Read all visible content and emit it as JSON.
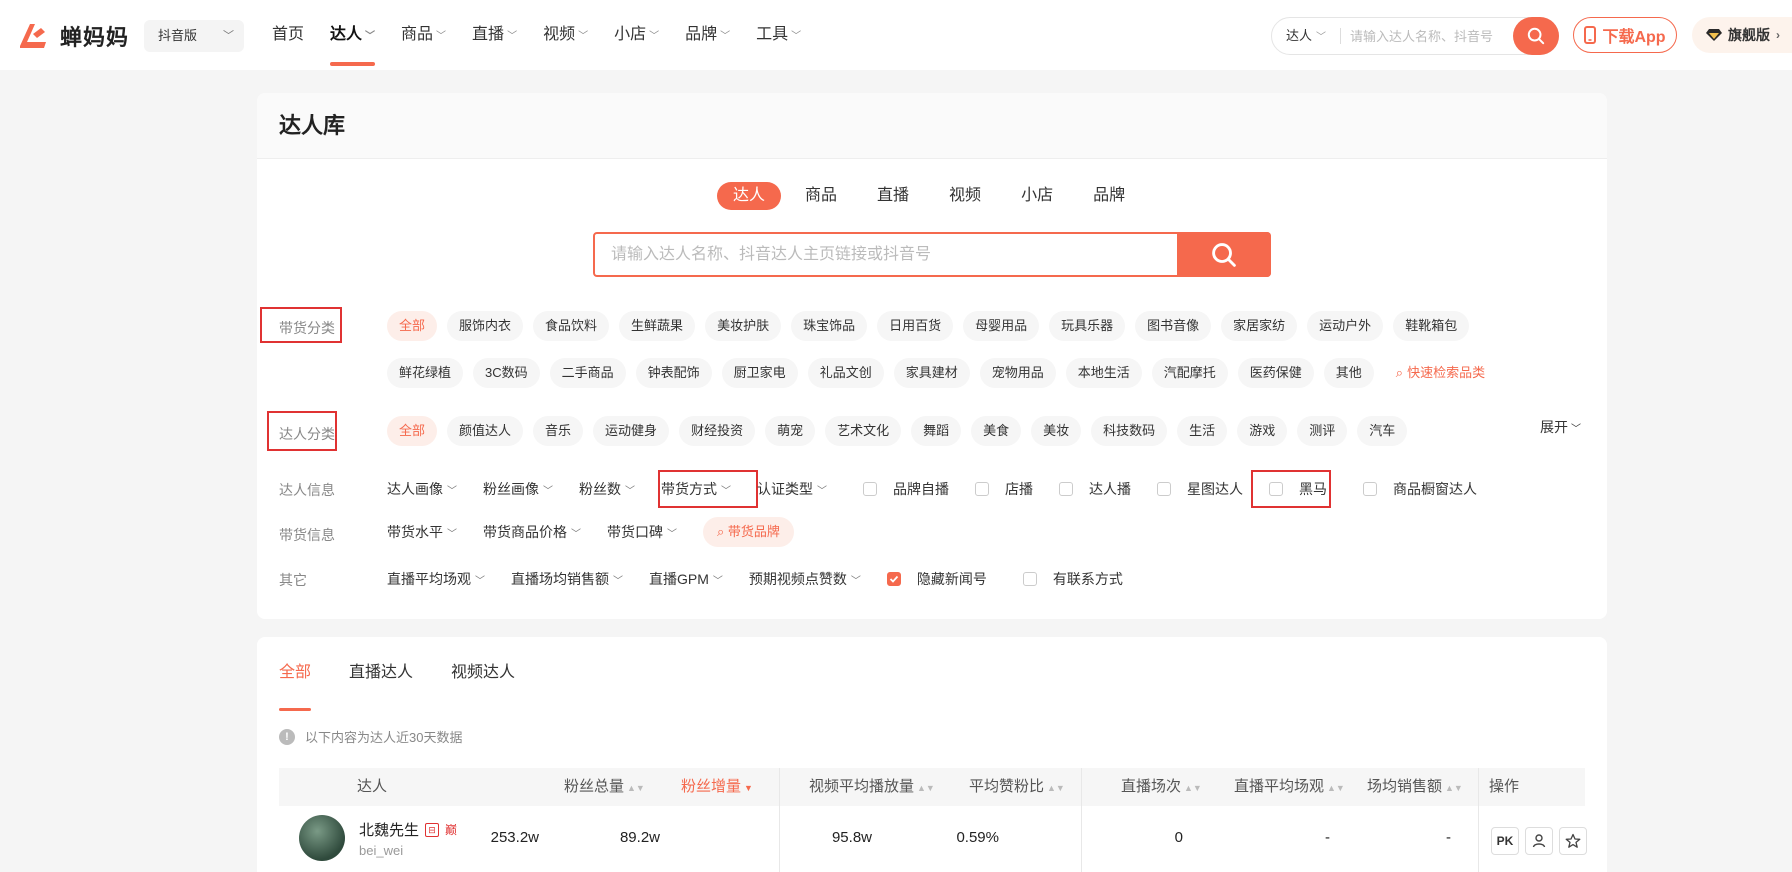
{
  "brand": {
    "name": "蝉妈妈",
    "accent": "#f5694d",
    "platform": "抖音版"
  },
  "nav": [
    {
      "label": "首页",
      "caret": false
    },
    {
      "label": "达人",
      "caret": true,
      "active": true
    },
    {
      "label": "商品",
      "caret": true
    },
    {
      "label": "直播",
      "caret": true
    },
    {
      "label": "视频",
      "caret": true
    },
    {
      "label": "小店",
      "caret": true
    },
    {
      "label": "品牌",
      "caret": true
    },
    {
      "label": "工具",
      "caret": true
    }
  ],
  "top_search": {
    "type": "达人",
    "placeholder": "请输入达人名称、抖音号"
  },
  "download_label": "下载App",
  "vip_label": "旗舰版",
  "page_title": "达人库",
  "type_tabs": [
    "达人",
    "商品",
    "直播",
    "视频",
    "小店",
    "品牌"
  ],
  "main_search": {
    "placeholder": "请输入达人名称、抖音达人主页链接或抖音号"
  },
  "filters": {
    "goods_category": {
      "label": "带货分类",
      "chips": [
        "全部",
        "服饰内衣",
        "食品饮料",
        "生鲜蔬果",
        "美妆护肤",
        "珠宝饰品",
        "日用百货",
        "母婴用品",
        "玩具乐器",
        "图书音像",
        "家居家纺",
        "运动户外",
        "鞋靴箱包",
        "鲜花绿植",
        "3C数码",
        "二手商品",
        "钟表配饰",
        "厨卫家电",
        "礼品文创",
        "家具建材",
        "宠物用品",
        "本地生活",
        "汽配摩托",
        "医药保健",
        "其他"
      ],
      "quick_search": "快速检索品类"
    },
    "influencer_category": {
      "label": "达人分类",
      "chips": [
        "全部",
        "颜值达人",
        "音乐",
        "运动健身",
        "财经投资",
        "萌宠",
        "艺术文化",
        "舞蹈",
        "美食",
        "美妆",
        "科技数码",
        "生活",
        "游戏",
        "测评",
        "汽车"
      ],
      "expand": "展开"
    },
    "influencer_info": {
      "label": "达人信息",
      "dropdowns": [
        "达人画像",
        "粉丝画像",
        "粉丝数",
        "带货方式",
        "认证类型"
      ],
      "checks": [
        "品牌自播",
        "店播",
        "达人播",
        "星图达人",
        "黑马",
        "商品橱窗达人"
      ]
    },
    "goods_info": {
      "label": "带货信息",
      "dropdowns": [
        "带货水平",
        "带货商品价格",
        "带货口碑"
      ],
      "brand_search": "带货品牌"
    },
    "other": {
      "label": "其它",
      "dropdowns": [
        "直播平均场观",
        "直播场均销售额",
        "直播GPM",
        "预期视频点赞数"
      ],
      "checks": [
        {
          "label": "隐藏新闻号",
          "checked": true
        },
        {
          "label": "有联系方式",
          "checked": false
        }
      ]
    }
  },
  "results": {
    "tabs": [
      "全部",
      "直播达人",
      "视频达人"
    ],
    "notice": "以下内容为达人近30天数据",
    "columns": [
      "达人",
      "粉丝总量",
      "粉丝增量",
      "视频平均播放量",
      "平均赞粉比",
      "直播场次",
      "直播平均场观",
      "场均销售额",
      "操作"
    ],
    "rows": [
      {
        "name": "北魏先生",
        "badge": "巅",
        "id": "bei_wei",
        "fans": "253.2w",
        "fans_inc": "89.2w",
        "avg_play": "95.8w",
        "like_ratio": "0.59%",
        "live_count": "0",
        "live_avg_view": "-",
        "avg_sales": "-",
        "pk": "PK"
      }
    ]
  }
}
